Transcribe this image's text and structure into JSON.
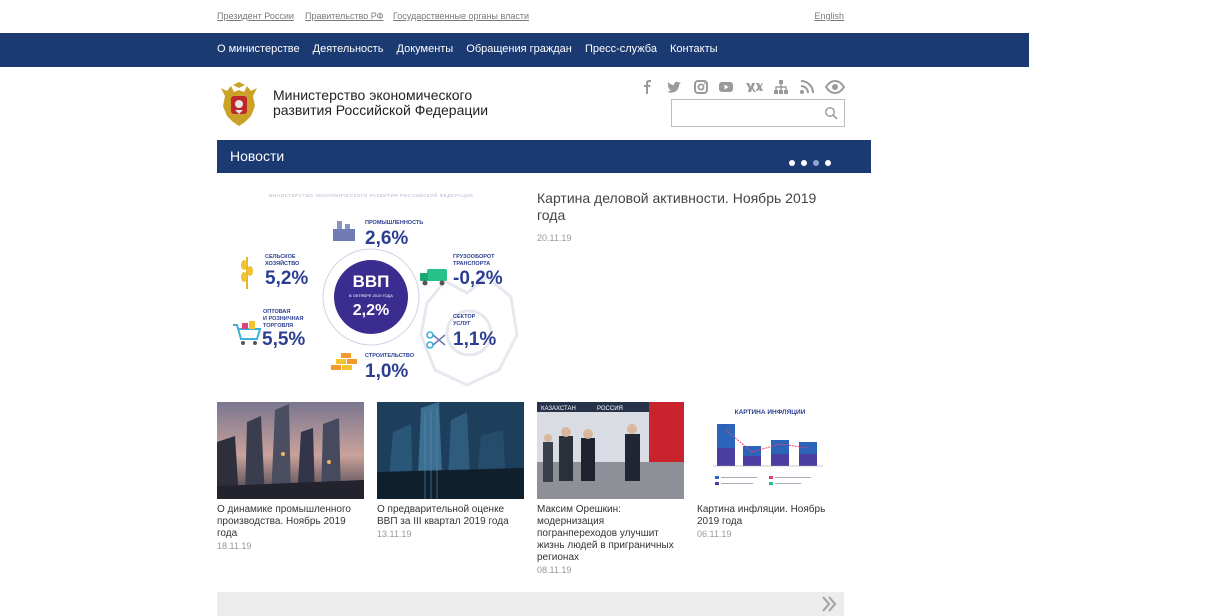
{
  "top_links": {
    "president": "Президент России",
    "government": "Правительство РФ",
    "gov_bodies": "Государственные органы власти",
    "english": "English"
  },
  "nav": [
    "О министерстве",
    "Деятельность",
    "Документы",
    "Обращения граждан",
    "Пресс-служба",
    "Контакты"
  ],
  "brand": {
    "name_line1": "Министерство экономического",
    "name_line2": "развития Российской Федерации"
  },
  "social_icons": [
    "facebook-icon",
    "twitter-icon",
    "instagram-icon",
    "youtube-icon",
    "vk-icon",
    "sitemap-icon",
    "rss-icon",
    "eye-icon"
  ],
  "search": {
    "placeholder": ""
  },
  "news": {
    "section_title": "Новости",
    "slides_total": 4,
    "slide_active": 3,
    "featured": {
      "title": "Картина деловой активности. Ноябрь 2019 года",
      "date": "20.11.19",
      "infographic": {
        "header": "МИНИСТЕРСТВО ЭКОНОМИЧЕСКОГО РАЗВИТИЯ РОССИЙСКОЙ ФЕДЕРАЦИИ",
        "center_label": "ВВП",
        "center_sub": "В ОКТЯБРЕ 2019 ГОДА",
        "center_value": "2,2%",
        "sectors": [
          {
            "label": "ПРОМЫШЛЕННОСТЬ",
            "value": "2,6%"
          },
          {
            "label": "СЕЛЬСКОЕ ХОЗЯЙСТВО",
            "value": "5,2%"
          },
          {
            "label": "ГРУЗООБОРОТ ТРАНСПОРТА",
            "value": "-0,2%"
          },
          {
            "label": "ОПТОВАЯ И РОЗНИЧНАЯ ТОРГОВЛЯ",
            "value": "5,5%"
          },
          {
            "label": "СЕКТОР УСЛУГ",
            "value": "1,1%"
          },
          {
            "label": "СТРОИТЕЛЬСТВО",
            "value": "1,0%"
          }
        ]
      }
    },
    "items": [
      {
        "title": "О динамике промышленного производства. Ноябрь 2019 года",
        "date": "18.11.19"
      },
      {
        "title": "О предварительной оценке ВВП за III квартал 2019 года",
        "date": "13.11.19"
      },
      {
        "title": "Максим Орешкин: модернизация погранпереходов улучшит жизнь людей в приграничных регионах",
        "date": "08.11.19",
        "photo_banner_left": "КАЗАХСТАН",
        "photo_banner_right": "РОССИЯ"
      },
      {
        "title": "Картина инфляции. Ноябрь 2019 года",
        "date": "06.11.19",
        "thumb_title": "КАРТИНА ИНФЛЯЦИИ"
      }
    ]
  },
  "colors": {
    "nav_bg": "#1b3a72",
    "accent_purple": "#3b2d8f",
    "text_blue": "#2b3e91"
  }
}
